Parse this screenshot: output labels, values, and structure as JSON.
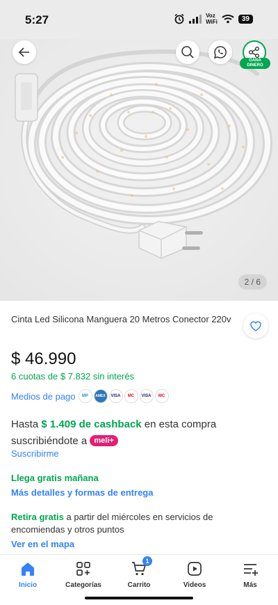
{
  "status_bar": {
    "time": "5:27",
    "network_top": "Voz",
    "network_bottom": "WiFi",
    "battery": "39"
  },
  "gallery": {
    "counter": "2 / 6",
    "share_badge_line1": "GANÁ",
    "share_badge_line2": "DINERO",
    "icons": [
      "back-arrow",
      "search",
      "whatsapp",
      "share"
    ]
  },
  "product": {
    "title": "Cinta Led Silicona Manguera 20 Metros Conector 220v",
    "price": "$ 46.990",
    "installments": "6 cuotas de $ 7.832 sin interés",
    "payment_label": "Medios de pago",
    "payment_logos": [
      "MP",
      "AMEX",
      "VISA",
      "MC",
      "VISA",
      "MC"
    ]
  },
  "cashback": {
    "prefix": "Hasta ",
    "amount": "$ 1.409 de cashback",
    "suffix": " en esta compra suscribiéndote a ",
    "badge": "meli+",
    "link": "Suscribirme"
  },
  "shipping": {
    "title": "Llega gratis mañana",
    "link": "Más detalles y formas de entrega"
  },
  "pickup": {
    "highlight": "Retira gratis",
    "text": " a partir del miércoles en servicios de encomiendas y otros puntos",
    "link": "Ver en el mapa"
  },
  "nav": {
    "items": [
      {
        "label": "Inicio"
      },
      {
        "label": "Categorías"
      },
      {
        "label": "Carrito"
      },
      {
        "label": "Videos"
      },
      {
        "label": "Más"
      }
    ],
    "cart_count": "1"
  },
  "colors": {
    "accent_blue": "#3483fa",
    "green": "#00a650",
    "meli_pink": "#e31f73"
  }
}
